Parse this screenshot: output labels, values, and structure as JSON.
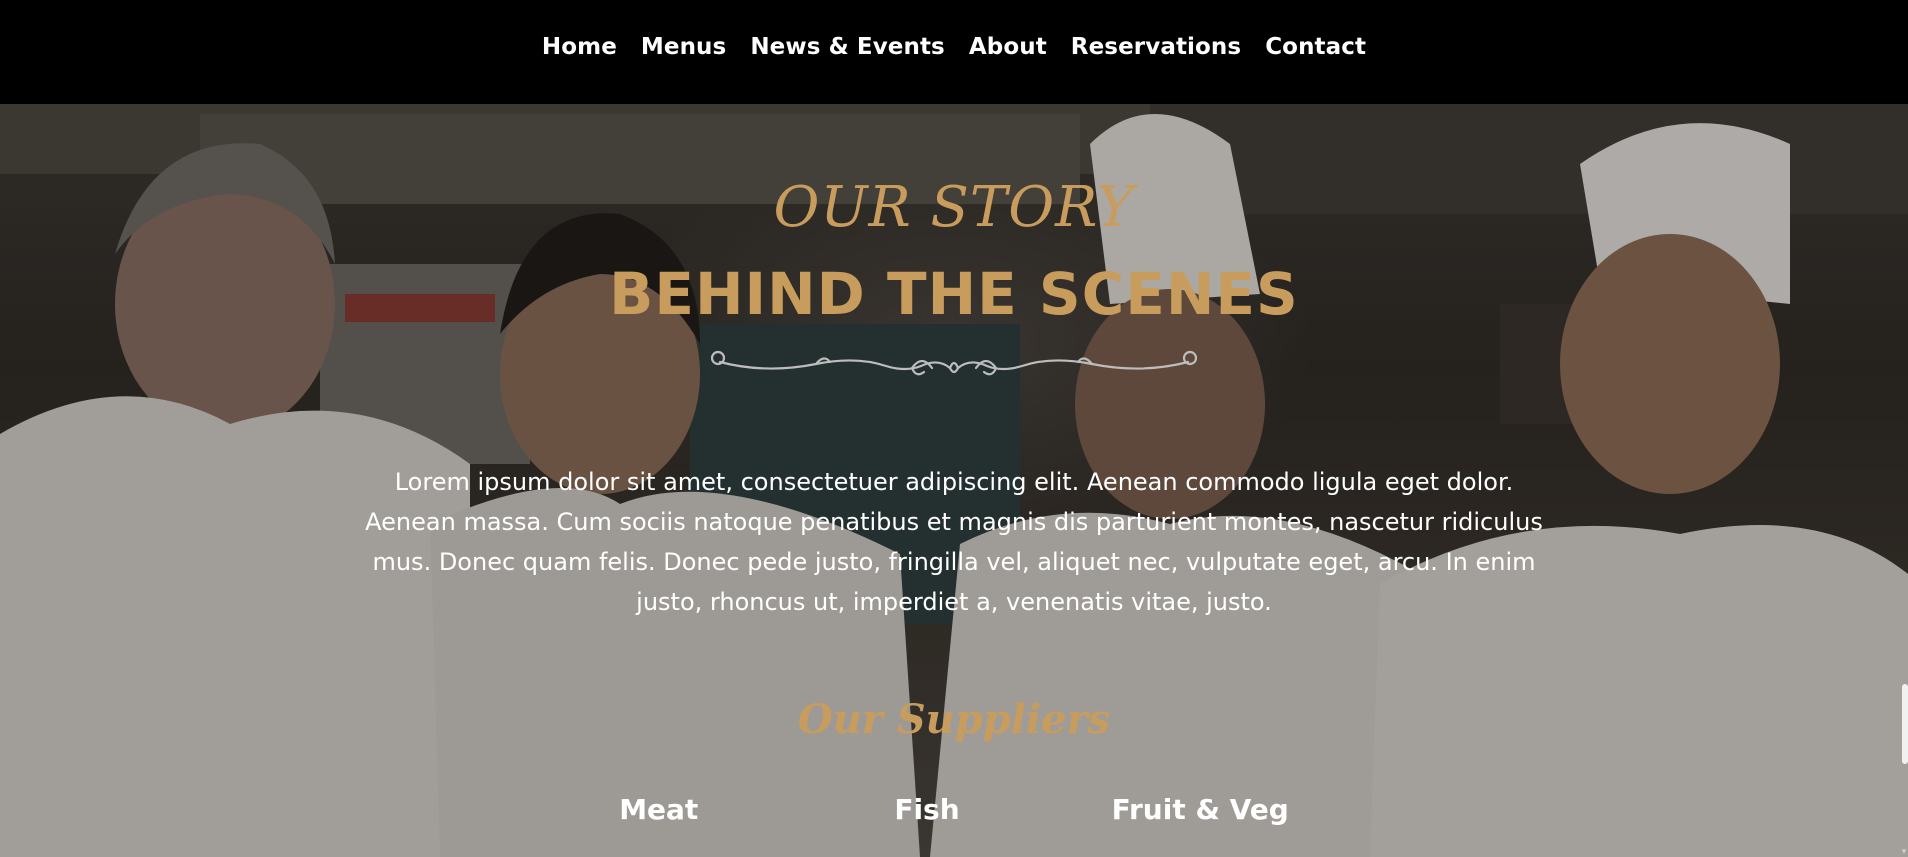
{
  "nav": {
    "items": [
      {
        "label": "Home"
      },
      {
        "label": "Menus"
      },
      {
        "label": "News & Events"
      },
      {
        "label": "About"
      },
      {
        "label": "Reservations"
      },
      {
        "label": "Contact"
      }
    ]
  },
  "hero": {
    "kicker": "OUR STORY",
    "title": "BEHIND THE SCENES",
    "intro": "Lorem ipsum dolor sit amet, consectetuer adipiscing elit. Aenean commodo ligula eget dolor. Aenean massa. Cum sociis natoque penatibus et magnis dis parturient montes, nascetur ridiculus mus. Donec quam felis. Donec pede justo, fringilla vel, aliquet nec, vulputate eget, arcu. In enim justo, rhoncus ut, imperdiet a, venenatis vitae, justo."
  },
  "suppliers": {
    "heading": "Our Suppliers",
    "items": [
      {
        "label": "Meat"
      },
      {
        "label": "Fish"
      },
      {
        "label": "Fruit & Veg"
      }
    ]
  },
  "colors": {
    "accent": "#c89c5c",
    "nav_background": "#000000",
    "text": "#ffffff"
  },
  "icons": {
    "divider": "ornamental-scroll-divider-icon"
  }
}
